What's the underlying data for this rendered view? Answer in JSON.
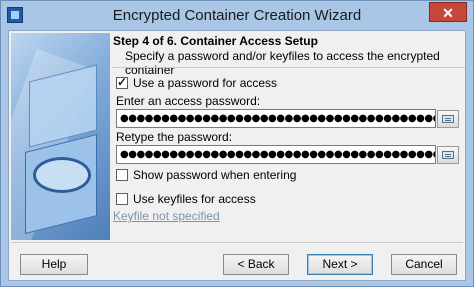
{
  "window": {
    "title": "Encrypted Container Creation Wizard",
    "close_glyph": "✕"
  },
  "header": {
    "step_title": "Step 4 of 6. Container Access Setup",
    "step_description": "Specify a password and/or keyfiles to access the encrypted container"
  },
  "form": {
    "use_password": {
      "label": "Use a password for access",
      "checked": true
    },
    "password_label": "Enter an access password:",
    "password_value": "●●●●●●●●●●●●●●●●●●●●●●●●●●●●●●●●●●●●●●●●●●●",
    "retype_label": "Retype the password:",
    "retype_value": "●●●●●●●●●●●●●●●●●●●●●●●●●●●●●●●●●●●●●●●●●●●",
    "show_password": {
      "label": "Show password when entering",
      "checked": false
    },
    "use_keyfiles": {
      "label": "Use keyfiles for access",
      "checked": false
    },
    "keyfile_status": "Keyfile not specified"
  },
  "buttons": {
    "help": "Help",
    "back": "< Back",
    "next": "Next >",
    "cancel": "Cancel"
  }
}
